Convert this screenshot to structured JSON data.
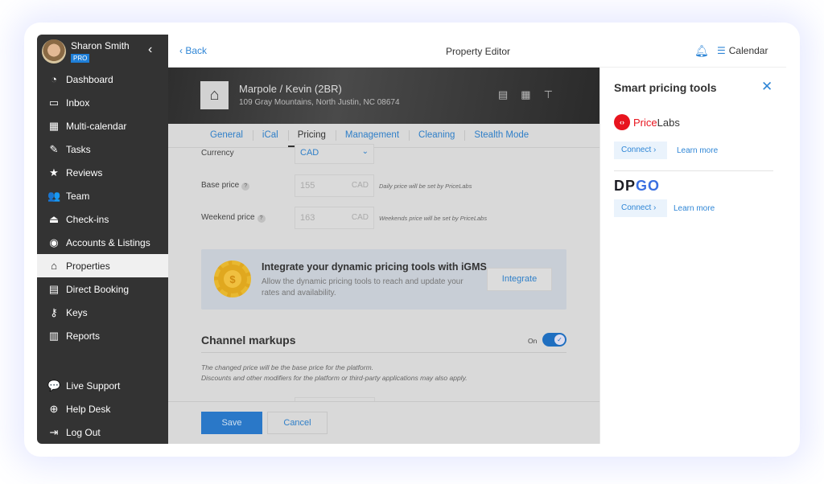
{
  "user": {
    "name": "Sharon Smith",
    "badge": "PRO"
  },
  "sidebar": {
    "items": [
      {
        "label": "Dashboard",
        "icon": "dashboard-icon",
        "glyph": "◔"
      },
      {
        "label": "Inbox",
        "icon": "inbox-icon",
        "glyph": "▭"
      },
      {
        "label": "Multi-calendar",
        "icon": "calendar-icon",
        "glyph": "▦"
      },
      {
        "label": "Tasks",
        "icon": "tasks-icon",
        "glyph": "✎"
      },
      {
        "label": "Reviews",
        "icon": "star-icon",
        "glyph": "★"
      },
      {
        "label": "Team",
        "icon": "team-icon",
        "glyph": "👥"
      },
      {
        "label": "Check-ins",
        "icon": "bell-icon",
        "glyph": "⏏"
      },
      {
        "label": "Accounts & Listings",
        "icon": "account-icon",
        "glyph": "◉"
      },
      {
        "label": "Properties",
        "icon": "home-icon",
        "glyph": "⌂"
      },
      {
        "label": "Direct Booking",
        "icon": "direct-booking-icon",
        "glyph": "▤"
      },
      {
        "label": "Keys",
        "icon": "key-icon",
        "glyph": "⚷"
      },
      {
        "label": "Reports",
        "icon": "reports-icon",
        "glyph": "▥"
      }
    ],
    "bottom": [
      {
        "label": "Live Support",
        "icon": "chat-icon",
        "glyph": "💬"
      },
      {
        "label": "Help Desk",
        "icon": "lifebuoy-icon",
        "glyph": "⊕"
      },
      {
        "label": "Log Out",
        "icon": "logout-icon",
        "glyph": "⇥"
      }
    ],
    "active": "Properties"
  },
  "header": {
    "back": "Back",
    "title": "Property Editor",
    "calendar": "Calendar"
  },
  "property": {
    "name": "Marpole / Kevin (2BR)",
    "address": "109 Gray Mountains, North Justin, NC 08674"
  },
  "tabs": [
    "General",
    "iCal",
    "Pricing",
    "Management",
    "Cleaning",
    "Stealth Mode"
  ],
  "active_tab": "Pricing",
  "form": {
    "currency_label": "Currency",
    "currency": "CAD",
    "base_label": "Base price",
    "base_value": "155",
    "base_unit": "CAD",
    "base_hint": "Daily price will be set by PriceLabs",
    "weekend_label": "Weekend price",
    "weekend_value": "163",
    "weekend_unit": "CAD",
    "weekend_hint": "Weekends price will be set by PriceLabs"
  },
  "promo": {
    "title": "Integrate your dynamic pricing tools with iGMS",
    "desc": "Allow the dynamic pricing tools to reach and update your rates and availability.",
    "button": "Integrate"
  },
  "markups": {
    "title": "Channel markups",
    "toggle_label": "On",
    "toggle_on": true,
    "desc1": "The changed price will be the base price for the platform.",
    "desc2": "Discounts and other modifiers for the platform or third-party applications may also apply."
  },
  "footer": {
    "save": "Save",
    "cancel": "Cancel"
  },
  "panel": {
    "title": "Smart pricing tools",
    "tools": [
      {
        "name_a": "Price",
        "name_b": "Labs",
        "connect": "Connect",
        "learn": "Learn more"
      },
      {
        "name_a": "DP",
        "name_b": "GO",
        "connect": "Connect",
        "learn": "Learn more"
      }
    ]
  },
  "colors": {
    "accent": "#2f86d6",
    "sidebar": "#333333",
    "pricelabs": "#e8141e"
  }
}
